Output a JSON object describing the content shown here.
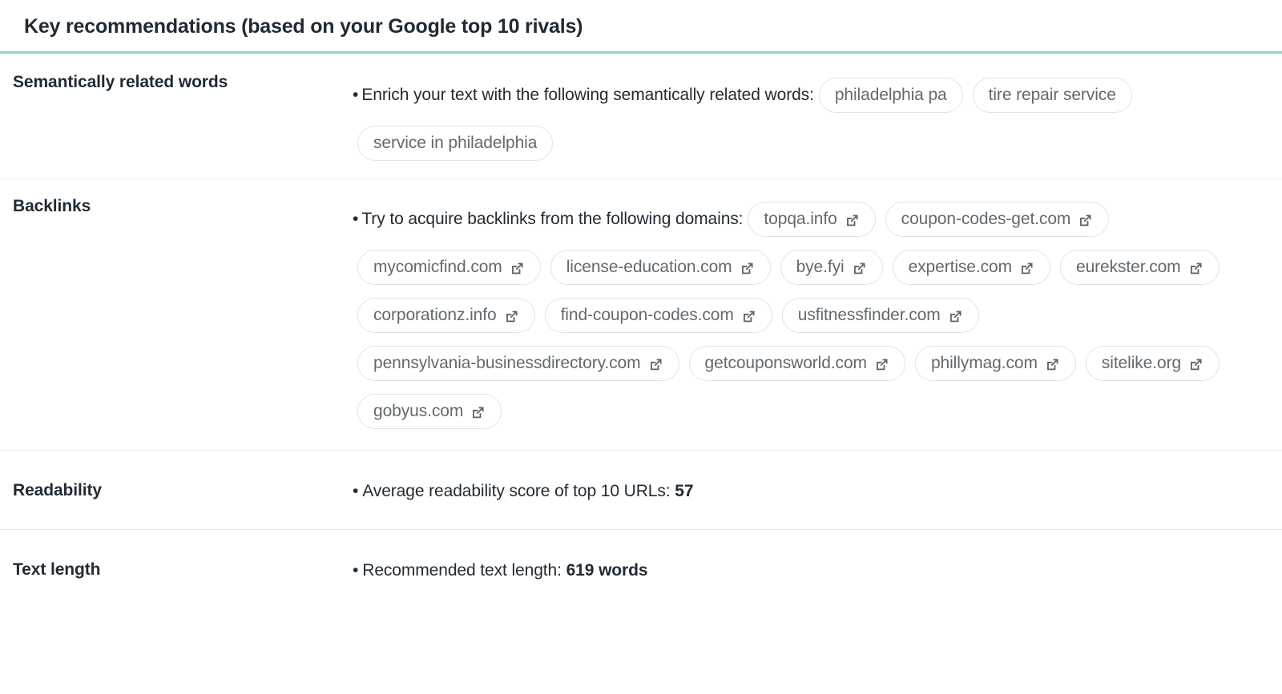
{
  "header": {
    "title": "Key recommendations (based on your Google top 10 rivals)",
    "accent_color": "#8cd9b3"
  },
  "rows": {
    "semantic": {
      "label": "Semantically related words",
      "bullet": "Enrich your text with the following semantically related words:",
      "pills": [
        "philadelphia pa",
        "tire repair service",
        "service in philadelphia"
      ]
    },
    "backlinks": {
      "label": "Backlinks",
      "bullet": "Try to acquire backlinks from the following domains:",
      "pills": [
        "topqa.info",
        "coupon-codes-get.com",
        "mycomicfind.com",
        "license-education.com",
        "bye.fyi",
        "expertise.com",
        "eurekster.com",
        "corporationz.info",
        "find-coupon-codes.com",
        "usfitnessfinder.com",
        "pennsylvania-businessdirectory.com",
        "getcouponsworld.com",
        "phillymag.com",
        "sitelike.org",
        "gobyus.com"
      ],
      "link_icon": "external-link-icon"
    },
    "readability": {
      "label": "Readability",
      "bullet_prefix": "Average readability score of top 10 URLs:",
      "value": "57"
    },
    "text_length": {
      "label": "Text length",
      "bullet_prefix": "Recommended text length:",
      "value": "619 words"
    }
  },
  "bullet_glyph": "•"
}
